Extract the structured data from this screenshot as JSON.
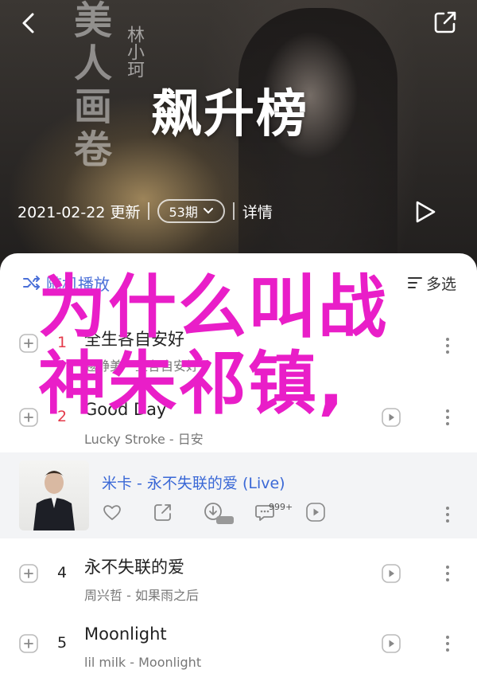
{
  "hero": {
    "calligraphy_text": "美人画卷",
    "artist_vertical": "林小珂",
    "chart_title": "飙升榜",
    "update_text": "2021-02-22 更新",
    "count_label": "53期",
    "details_label": "详情"
  },
  "toolbar": {
    "shuffle_label": "随机播放",
    "multi_select_label": "多选"
  },
  "overlay": {
    "line1": "为什么叫战",
    "line2": "神朱祁镇,"
  },
  "songs": [
    {
      "rank": "1",
      "title": "全生各自安好",
      "subtitle": "越静美 - 生各自安好",
      "rank_color": "red"
    },
    {
      "rank": "2",
      "title": "Good Day",
      "subtitle": "Lucky Stroke - 日安",
      "rank_color": "red"
    },
    {
      "title": "米卡 - 永不失联的爱 (Live)",
      "comments_badge": "999+"
    },
    {
      "rank": "4",
      "title": "永不失联的爱",
      "subtitle": "周兴哲 - 如果雨之后"
    },
    {
      "rank": "5",
      "title": "Moonlight",
      "subtitle": "lil milk - Moonlight"
    }
  ],
  "colors": {
    "accent_blue": "#3a68d6",
    "rank_red": "#e43a4a",
    "overlay_magenta": "#e91ec8"
  }
}
